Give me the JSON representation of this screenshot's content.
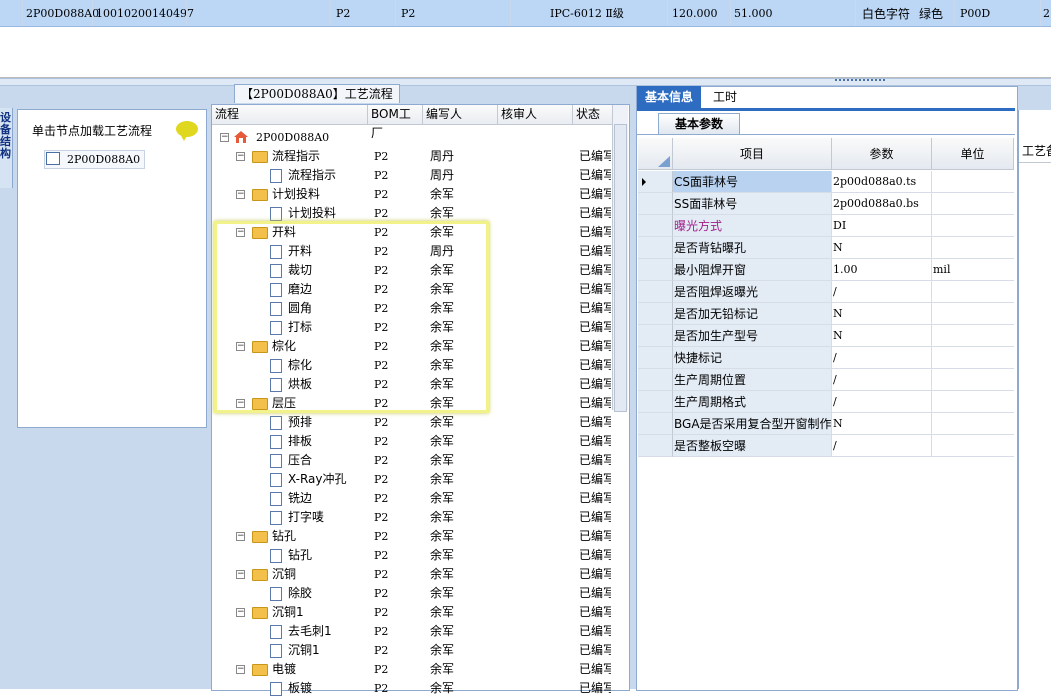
{
  "top_row": {
    "code": "2P00D088A0",
    "number": "10010200140497",
    "factory1": "P2",
    "factory2": "P2",
    "standard": "IPC-6012 Ⅱ级",
    "thickness": "120.000",
    "width": "51.000",
    "char_color": "白色字符",
    "mask_color": "绿色",
    "code2": "P00D",
    "edge": "2"
  },
  "left": {
    "strip_label": "设备结构",
    "hint": "单击节点加载工艺流程",
    "hint_icon": "speech-bubble-icon",
    "node": "2P00D088A0"
  },
  "tree": {
    "tab": "【2P00D088A0】工艺流程",
    "headers": [
      "流程",
      "BOM工厂",
      "编写人",
      "核审人",
      "状态"
    ],
    "root": "2P00D088A0",
    "rows": [
      {
        "name": "流程指示",
        "type": "folder",
        "bom": "P2",
        "writer": "周丹",
        "reviewer": "",
        "status": "已编写"
      },
      {
        "name": "流程指示",
        "type": "doc",
        "bom": "P2",
        "writer": "周丹",
        "reviewer": "",
        "status": "已编写"
      },
      {
        "name": "计划投料",
        "type": "folder",
        "bom": "P2",
        "writer": "余军",
        "reviewer": "",
        "status": "已编写"
      },
      {
        "name": "计划投料",
        "type": "doc",
        "bom": "P2",
        "writer": "余军",
        "reviewer": "",
        "status": "已编写"
      },
      {
        "name": "开料",
        "type": "folder",
        "bom": "P2",
        "writer": "余军",
        "reviewer": "",
        "status": "已编写"
      },
      {
        "name": "开料",
        "type": "doc",
        "bom": "P2",
        "writer": "周丹",
        "reviewer": "",
        "status": "已编写"
      },
      {
        "name": "裁切",
        "type": "doc",
        "bom": "P2",
        "writer": "余军",
        "reviewer": "",
        "status": "已编写"
      },
      {
        "name": "磨边",
        "type": "doc",
        "bom": "P2",
        "writer": "余军",
        "reviewer": "",
        "status": "已编写"
      },
      {
        "name": "圆角",
        "type": "doc",
        "bom": "P2",
        "writer": "余军",
        "reviewer": "",
        "status": "已编写"
      },
      {
        "name": "打标",
        "type": "doc",
        "bom": "P2",
        "writer": "余军",
        "reviewer": "",
        "status": "已编写"
      },
      {
        "name": "棕化",
        "type": "folder",
        "bom": "P2",
        "writer": "余军",
        "reviewer": "",
        "status": "已编写"
      },
      {
        "name": "棕化",
        "type": "doc",
        "bom": "P2",
        "writer": "余军",
        "reviewer": "",
        "status": "已编写"
      },
      {
        "name": "烘板",
        "type": "doc",
        "bom": "P2",
        "writer": "余军",
        "reviewer": "",
        "status": "已编写"
      },
      {
        "name": "层压",
        "type": "folder",
        "bom": "P2",
        "writer": "余军",
        "reviewer": "",
        "status": "已编写"
      },
      {
        "name": "预排",
        "type": "doc",
        "bom": "P2",
        "writer": "余军",
        "reviewer": "",
        "status": "已编写"
      },
      {
        "name": "排板",
        "type": "doc",
        "bom": "P2",
        "writer": "余军",
        "reviewer": "",
        "status": "已编写"
      },
      {
        "name": "压合",
        "type": "doc",
        "bom": "P2",
        "writer": "余军",
        "reviewer": "",
        "status": "已编写"
      },
      {
        "name": "X-Ray冲孔",
        "type": "doc",
        "bom": "P2",
        "writer": "余军",
        "reviewer": "",
        "status": "已编写"
      },
      {
        "name": "铣边",
        "type": "doc",
        "bom": "P2",
        "writer": "余军",
        "reviewer": "",
        "status": "已编写"
      },
      {
        "name": "打字唛",
        "type": "doc",
        "bom": "P2",
        "writer": "余军",
        "reviewer": "",
        "status": "已编写"
      },
      {
        "name": "钻孔",
        "type": "folder",
        "bom": "P2",
        "writer": "余军",
        "reviewer": "",
        "status": "已编写"
      },
      {
        "name": "钻孔",
        "type": "doc",
        "bom": "P2",
        "writer": "余军",
        "reviewer": "",
        "status": "已编写"
      },
      {
        "name": "沉铜",
        "type": "folder",
        "bom": "P2",
        "writer": "余军",
        "reviewer": "",
        "status": "已编写"
      },
      {
        "name": "除胶",
        "type": "doc",
        "bom": "P2",
        "writer": "余军",
        "reviewer": "",
        "status": "已编写"
      },
      {
        "name": "沉铜1",
        "type": "folder",
        "bom": "P2",
        "writer": "余军",
        "reviewer": "",
        "status": "已编写"
      },
      {
        "name": "去毛刺1",
        "type": "doc",
        "bom": "P2",
        "writer": "余军",
        "reviewer": "",
        "status": "已编写"
      },
      {
        "name": "沉铜1",
        "type": "doc",
        "bom": "P2",
        "writer": "余军",
        "reviewer": "",
        "status": "已编写"
      },
      {
        "name": "电镀",
        "type": "folder",
        "bom": "P2",
        "writer": "余军",
        "reviewer": "",
        "status": "已编写"
      },
      {
        "name": "板镀",
        "type": "doc",
        "bom": "P2",
        "writer": "余军",
        "reviewer": "",
        "status": "已编写"
      }
    ]
  },
  "right": {
    "tabs": [
      "基本信息",
      "工时"
    ],
    "subtab": "基本参数",
    "grid_headers": [
      "项目",
      "参数",
      "单位"
    ],
    "rows": [
      {
        "item": "CS面菲林号",
        "value": "2p00d088a0.ts",
        "unit": "",
        "current": true
      },
      {
        "item": "SS面菲林号",
        "value": "2p00d088a0.bs",
        "unit": ""
      },
      {
        "item": "曝光方式",
        "value": "DI",
        "unit": "",
        "highlight": true
      },
      {
        "item": "是否背钻曝孔",
        "value": "N",
        "unit": ""
      },
      {
        "item": "最小阻焊开窗",
        "value": "1.00",
        "unit": "mil"
      },
      {
        "item": "是否阻焊返曝光",
        "value": "/",
        "unit": ""
      },
      {
        "item": "是否加无铅标记",
        "value": "N",
        "unit": ""
      },
      {
        "item": "是否加生产型号",
        "value": "N",
        "unit": ""
      },
      {
        "item": "快捷标记",
        "value": "/",
        "unit": ""
      },
      {
        "item": "生产周期位置",
        "value": "/",
        "unit": ""
      },
      {
        "item": "生产周期格式",
        "value": "/",
        "unit": ""
      },
      {
        "item": "BGA是否采用复合型开窗制作",
        "value": "N",
        "unit": ""
      },
      {
        "item": "是否整板空曝",
        "value": "/",
        "unit": ""
      }
    ],
    "far_right_label": "工艺备注"
  },
  "colors": {
    "selection": "#bcd7f5",
    "tab_active": "#2d6cc0",
    "highlight_item": "#a0208a",
    "folder": "#f3c14b",
    "annotation_box": "#f2f28a"
  }
}
